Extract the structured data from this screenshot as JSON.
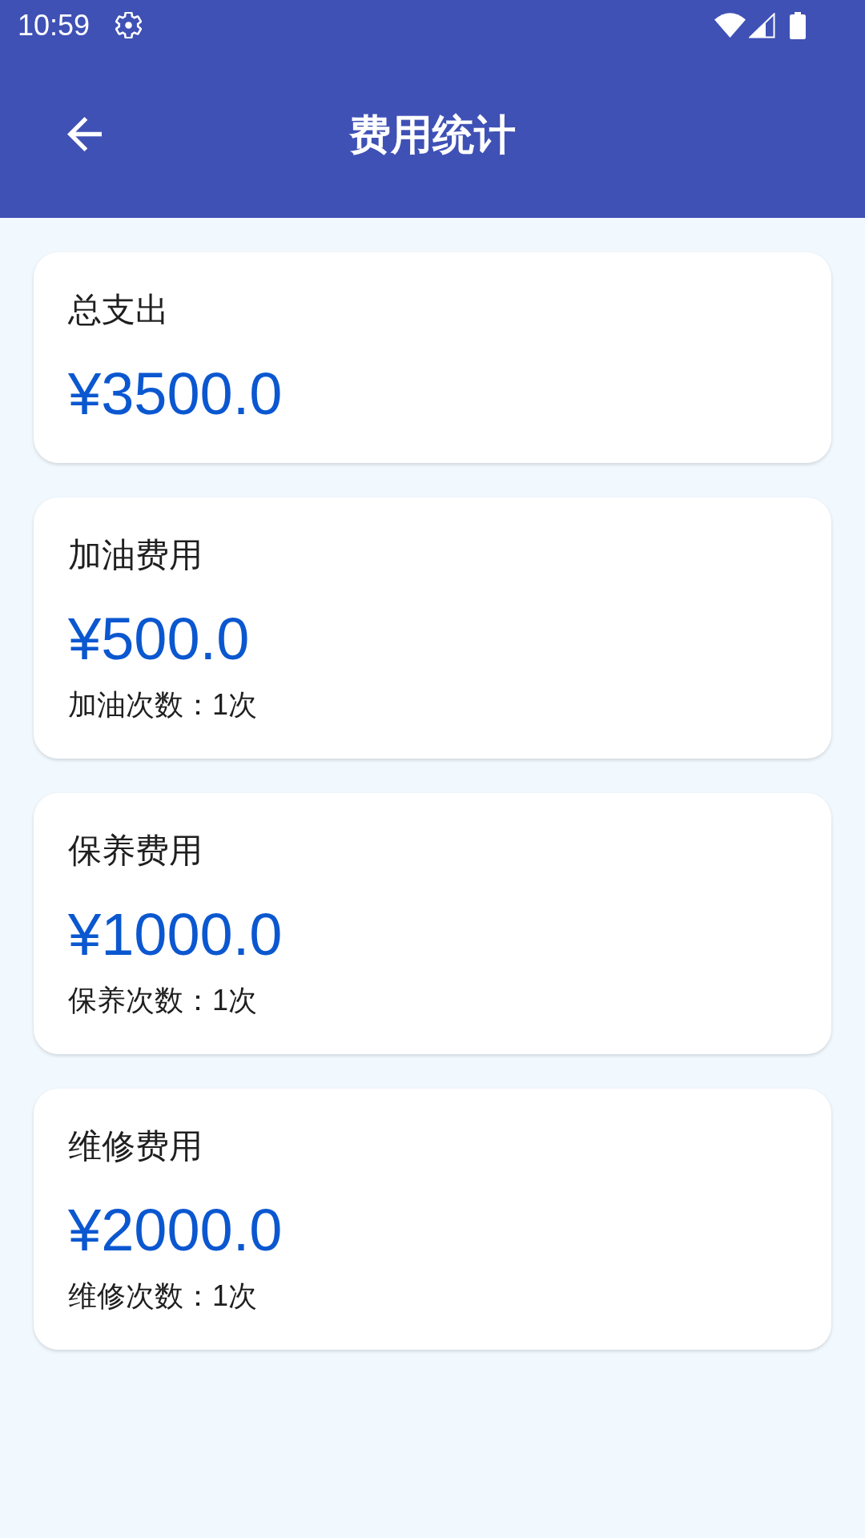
{
  "status_bar": {
    "time": "10:59"
  },
  "app_bar": {
    "title": "费用统计"
  },
  "cards": [
    {
      "label": "总支出",
      "amount": "¥3500.0"
    },
    {
      "label": "加油费用",
      "amount": "¥500.0",
      "count": "加油次数：1次"
    },
    {
      "label": "保养费用",
      "amount": "¥1000.0",
      "count": "保养次数：1次"
    },
    {
      "label": "维修费用",
      "amount": "¥2000.0",
      "count": "维修次数：1次"
    }
  ]
}
